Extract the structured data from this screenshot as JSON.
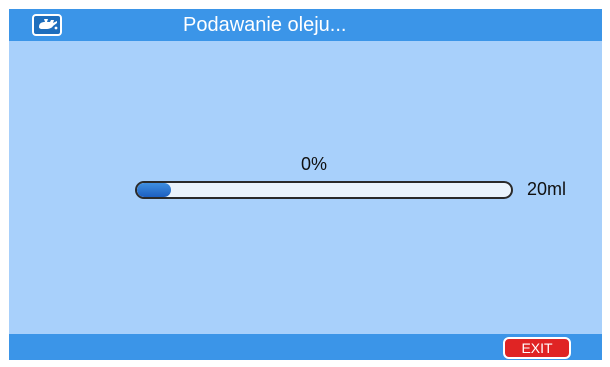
{
  "title_bar": {
    "title": "Podawanie oleju...",
    "icon": "oil-can-icon"
  },
  "progress": {
    "percent_label": "0%",
    "value": 0,
    "volume_label": "20ml"
  },
  "bottom_bar": {
    "exit_label": "EXIT"
  },
  "colors": {
    "background": "#a8d0fb",
    "bars": "#3b95e8",
    "progress_fill": "#1c5fc0",
    "exit_button": "#e02424"
  }
}
